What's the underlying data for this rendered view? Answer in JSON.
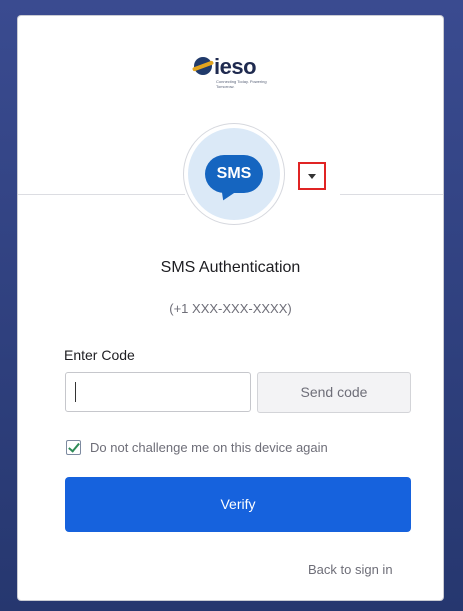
{
  "brand": {
    "name": "ieso",
    "tagline": "Connecting Today. Powering Tomorrow."
  },
  "factor": {
    "icon_label": "SMS",
    "title": "SMS Authentication",
    "phone": "(+1 XXX-XXX-XXXX)"
  },
  "form": {
    "code_label": "Enter Code",
    "code_value": "",
    "send_label": "Send code",
    "remember_label": "Do not challenge me on this device again",
    "remember_checked": true,
    "verify_label": "Verify"
  },
  "links": {
    "back_label": "Back to sign in"
  },
  "colors": {
    "primary": "#1662dd",
    "sms_bubble": "#1565c0",
    "highlight": "#e02424",
    "frame": "#2e3f82"
  }
}
